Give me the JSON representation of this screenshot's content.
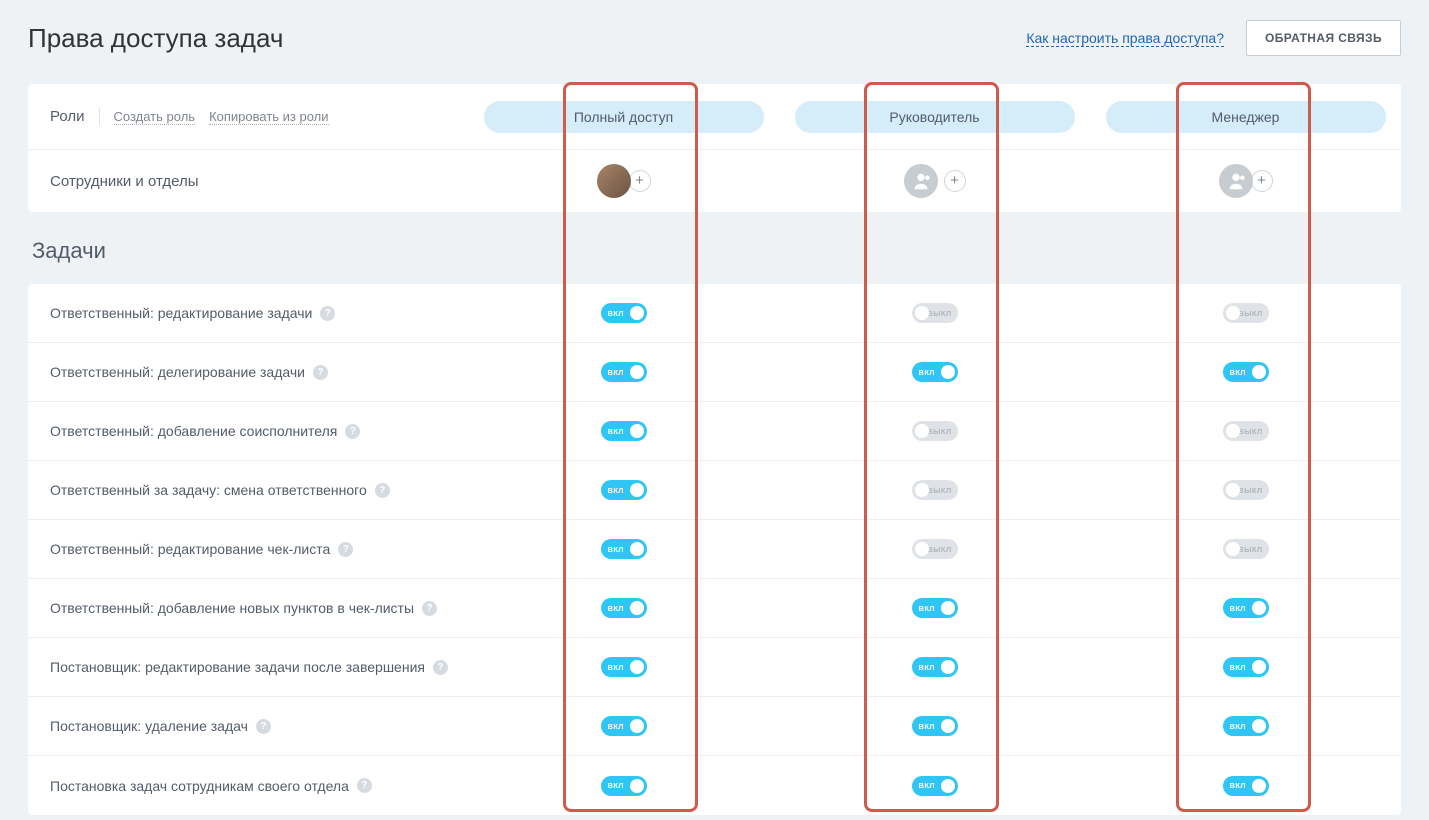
{
  "header": {
    "title": "Права доступа задач",
    "help_link": "Как настроить права доступа?",
    "feedback_button": "ОБРАТНАЯ СВЯЗЬ"
  },
  "table_header": {
    "roles_label": "Роли",
    "create_role": "Создать роль",
    "copy_from_role": "Копировать из роли",
    "columns": [
      "Полный доступ",
      "Руководитель",
      "Менеджер"
    ],
    "employees_label": "Сотрудники и отделы"
  },
  "section": {
    "tasks_title": "Задачи"
  },
  "toggle_labels": {
    "on": "ВКЛ",
    "off": "ВЫКЛ"
  },
  "permissions": [
    {
      "label": "Ответственный: редактирование задачи",
      "values": [
        "on",
        "off",
        "off"
      ]
    },
    {
      "label": "Ответственный: делегирование задачи",
      "values": [
        "on",
        "on",
        "on"
      ]
    },
    {
      "label": "Ответственный: добавление соисполнителя",
      "values": [
        "on",
        "off",
        "off"
      ]
    },
    {
      "label": "Ответственный за задачу: смена ответственного",
      "values": [
        "on",
        "off",
        "off"
      ]
    },
    {
      "label": "Ответственный: редактирование чек-листа",
      "values": [
        "on",
        "off",
        "off"
      ]
    },
    {
      "label": "Ответственный: добавление новых пунктов в чек-листы",
      "values": [
        "on",
        "on",
        "on"
      ]
    },
    {
      "label": "Постановщик: редактирование задачи после завершения",
      "values": [
        "on",
        "on",
        "on"
      ]
    },
    {
      "label": "Постановщик: удаление задач",
      "values": [
        "on",
        "on",
        "on"
      ]
    },
    {
      "label": "Постановка задач сотрудникам своего отдела",
      "values": [
        "on",
        "on",
        "on"
      ]
    }
  ]
}
